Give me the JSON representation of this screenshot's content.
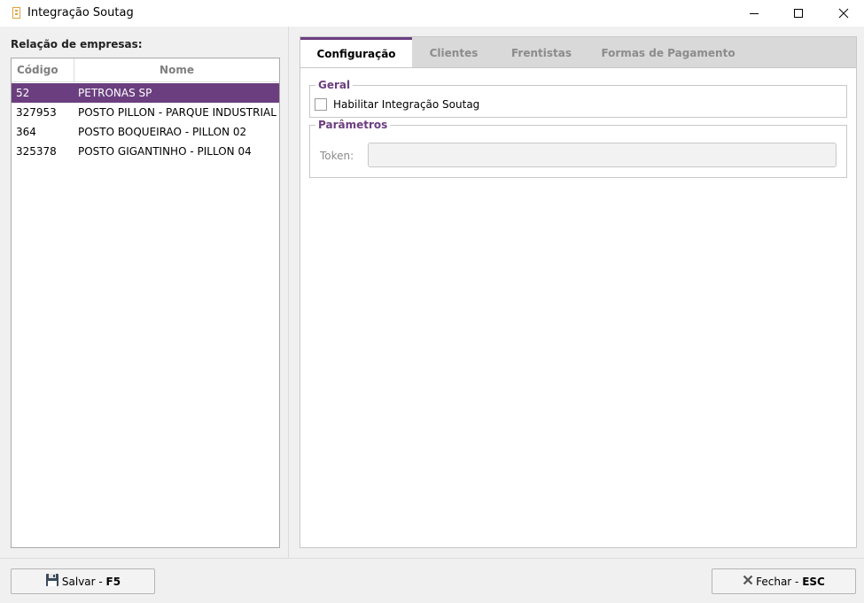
{
  "window": {
    "title": "Integração Soutag",
    "minimize_glyph": "—",
    "maximize_glyph": "☐",
    "close_glyph": "✕"
  },
  "left": {
    "title": "Relação de empresas:",
    "columns": {
      "codigo": "Código",
      "nome": "Nome"
    },
    "rows": [
      {
        "codigo": "52",
        "nome": "PETRONAS SP",
        "selected": true
      },
      {
        "codigo": "327953",
        "nome": "POSTO PILLON - PARQUE INDUSTRIAL -",
        "selected": false
      },
      {
        "codigo": "364",
        "nome": "POSTO BOQUEIRAO - PILLON 02",
        "selected": false
      },
      {
        "codigo": "325378",
        "nome": "POSTO GIGANTINHO - PILLON 04",
        "selected": false
      }
    ]
  },
  "tabs": [
    {
      "label": "Configuração",
      "active": true
    },
    {
      "label": "Clientes",
      "active": false
    },
    {
      "label": "Frentistas",
      "active": false
    },
    {
      "label": "Formas de Pagamento",
      "active": false
    }
  ],
  "config": {
    "geral_title": "Geral",
    "habilitar_label": "Habilitar Integração Soutag",
    "habilitar_checked": false,
    "parametros_title": "Parâmetros",
    "token_label": "Token:",
    "token_value": ""
  },
  "buttons": {
    "save_text": "Salvar - ",
    "save_key": "F5",
    "close_text": "Fechar - ",
    "close_key": "ESC"
  },
  "colors": {
    "accent": "#6b3f7f",
    "selection": "#6b3f7f",
    "tab_inactive_text": "#8c8c8c"
  },
  "icons": {
    "app": "app-icon",
    "save": "floppy-disk-icon",
    "close": "close-x-icon"
  }
}
